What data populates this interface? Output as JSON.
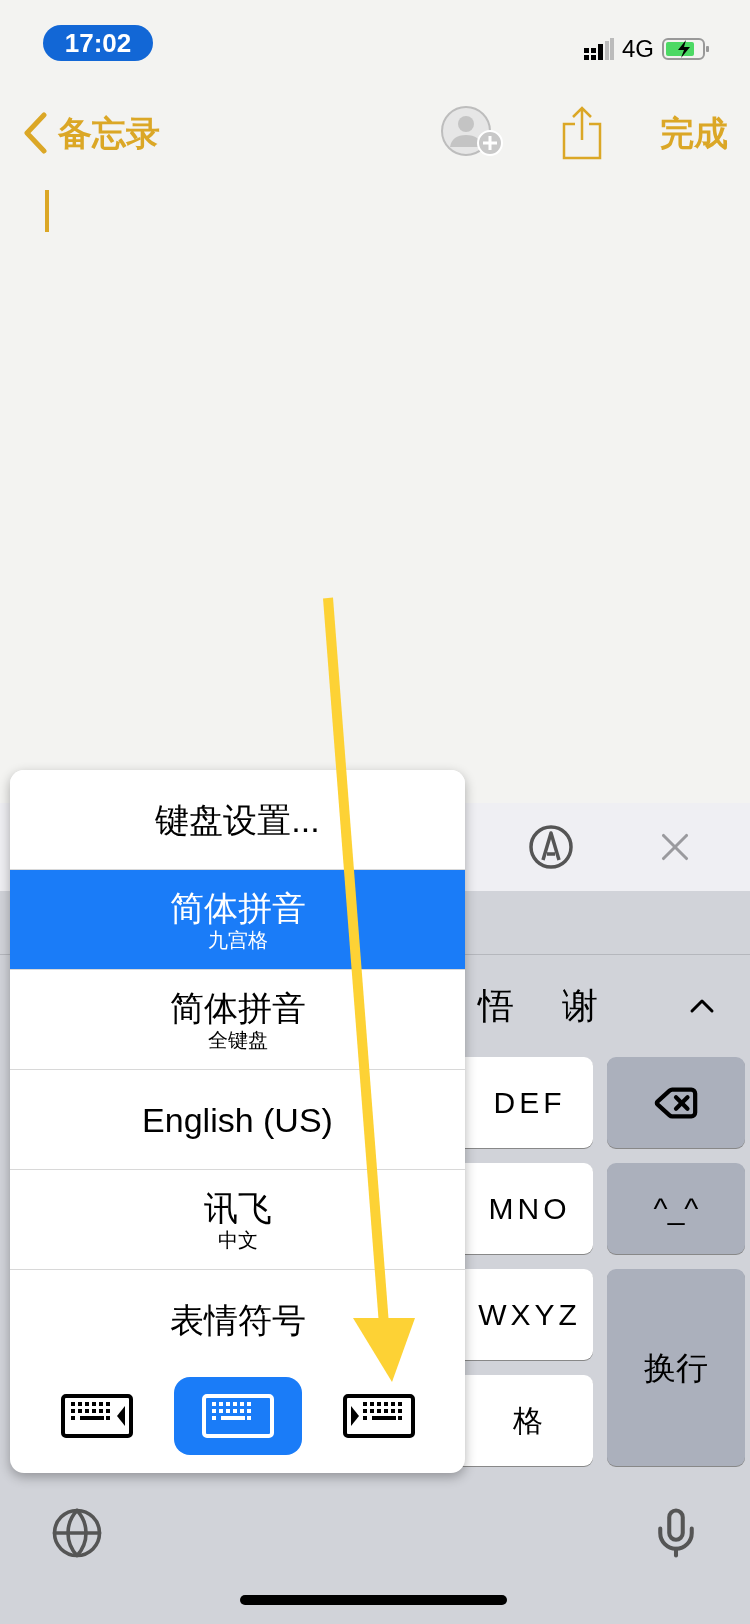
{
  "status_bar": {
    "time": "17:02",
    "network": "4G"
  },
  "nav": {
    "back_label": "备忘录",
    "done": "完成"
  },
  "keyboard": {
    "candidates": [
      "悟",
      "谢"
    ],
    "middle_keys": [
      {
        "label": "DEF"
      },
      {
        "label": "MNO"
      },
      {
        "label": "WXYZ"
      },
      {
        "label": "格"
      }
    ],
    "side_keys": [
      {
        "kind": "delete"
      },
      {
        "kind": "text",
        "label": "^_^"
      },
      {
        "kind": "tall",
        "label": "换行"
      }
    ]
  },
  "popup": {
    "items": [
      {
        "label": "键盘设置...",
        "selected": false
      },
      {
        "label": "简体拼音",
        "sublabel": "九宫格",
        "selected": true
      },
      {
        "label": "简体拼音",
        "sublabel": "全键盘",
        "selected": false
      },
      {
        "label": "English (US)",
        "selected": false
      },
      {
        "label": "讯飞",
        "sublabel": "中文",
        "selected": false
      },
      {
        "label": "表情符号",
        "selected": false
      }
    ],
    "layouts": [
      {
        "kind": "left",
        "selected": false
      },
      {
        "kind": "center",
        "selected": true
      },
      {
        "kind": "right",
        "selected": false
      }
    ]
  }
}
